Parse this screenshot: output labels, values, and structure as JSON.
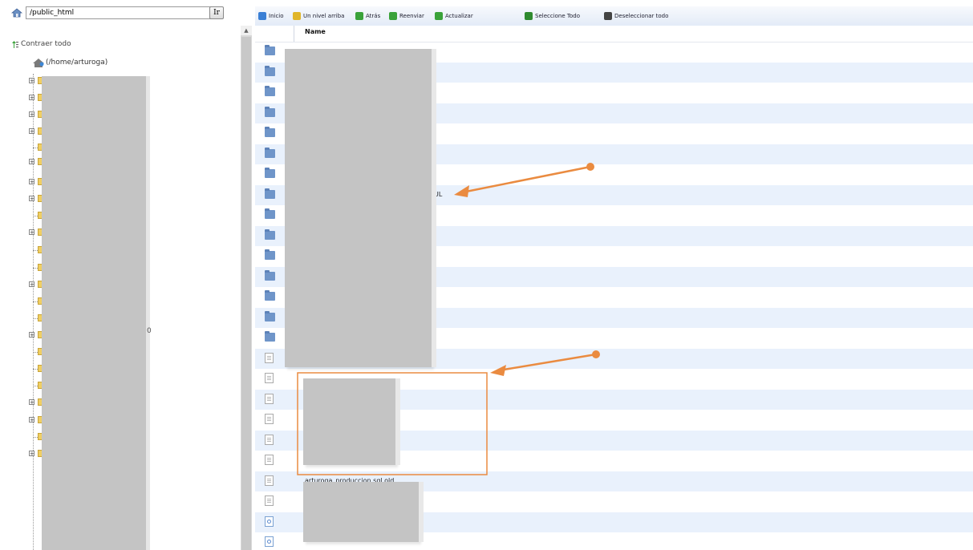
{
  "sidebar": {
    "path_value": "/public_html",
    "go_label": "Ir",
    "collapse_label": "Contraer todo",
    "root_label": "(/home/arturoga)",
    "stray_mark": "0",
    "tree_nodes": [
      {
        "expand": "+"
      },
      {
        "expand": "+"
      },
      {
        "expand": "+"
      },
      {
        "expand": "+"
      },
      {
        "expand": ""
      },
      {
        "expand": "+"
      },
      {
        "expand": "+"
      },
      {
        "expand": "+"
      },
      {
        "expand": ""
      },
      {
        "expand": "+"
      },
      {
        "expand": ""
      },
      {
        "expand": ""
      },
      {
        "expand": "+"
      },
      {
        "expand": ""
      },
      {
        "expand": ""
      },
      {
        "expand": "+"
      },
      {
        "expand": ""
      },
      {
        "expand": ""
      },
      {
        "expand": ""
      },
      {
        "expand": "+"
      },
      {
        "expand": "+"
      },
      {
        "expand": ""
      },
      {
        "expand": "+"
      }
    ]
  },
  "toolbar": {
    "items": [
      {
        "label": "Inicio",
        "icon": "home-icon",
        "color": "#3a7fd5"
      },
      {
        "label": "Un nivel arriba",
        "icon": "folder-up-icon",
        "color": "#e0b52a"
      },
      {
        "label": "Atrás",
        "icon": "arrow-left-icon",
        "color": "#3aa23a"
      },
      {
        "label": "Reenviar",
        "icon": "arrow-right-icon",
        "color": "#3aa23a"
      },
      {
        "label": "Actualizar",
        "icon": "refresh-icon",
        "color": "#3aa23a"
      },
      {
        "label": "Seleccione Todo",
        "icon": "check-all-icon",
        "color": "#2f8a2f"
      },
      {
        "label": "Deseleccionar todo",
        "icon": "uncheck-all-icon",
        "color": "#444444"
      }
    ]
  },
  "filelist": {
    "column_name": "Name",
    "rows": [
      {
        "type": "folder",
        "name": ""
      },
      {
        "type": "folder",
        "name": ""
      },
      {
        "type": "folder",
        "name": ""
      },
      {
        "type": "folder",
        "name": ""
      },
      {
        "type": "folder",
        "name": ""
      },
      {
        "type": "folder",
        "name": ""
      },
      {
        "type": "folder",
        "name": ""
      },
      {
        "type": "folder",
        "name": "UL"
      },
      {
        "type": "folder",
        "name": ""
      },
      {
        "type": "folder",
        "name": ""
      },
      {
        "type": "folder",
        "name": ""
      },
      {
        "type": "folder",
        "name": ""
      },
      {
        "type": "folder",
        "name": ""
      },
      {
        "type": "folder",
        "name": ""
      },
      {
        "type": "folder",
        "name": ""
      },
      {
        "type": "file",
        "name": ""
      },
      {
        "type": "file",
        "name": ""
      },
      {
        "type": "file",
        "name": ""
      },
      {
        "type": "file",
        "name": ""
      },
      {
        "type": "file",
        "name": ""
      },
      {
        "type": "file",
        "name": ""
      },
      {
        "type": "file",
        "name": "arturoga_produccion.sql.old"
      },
      {
        "type": "file",
        "name": ""
      },
      {
        "type": "fileblue",
        "name": ""
      },
      {
        "type": "fileblue",
        "name": ""
      }
    ]
  },
  "annotations": {
    "accent_color": "#ea8b40"
  }
}
